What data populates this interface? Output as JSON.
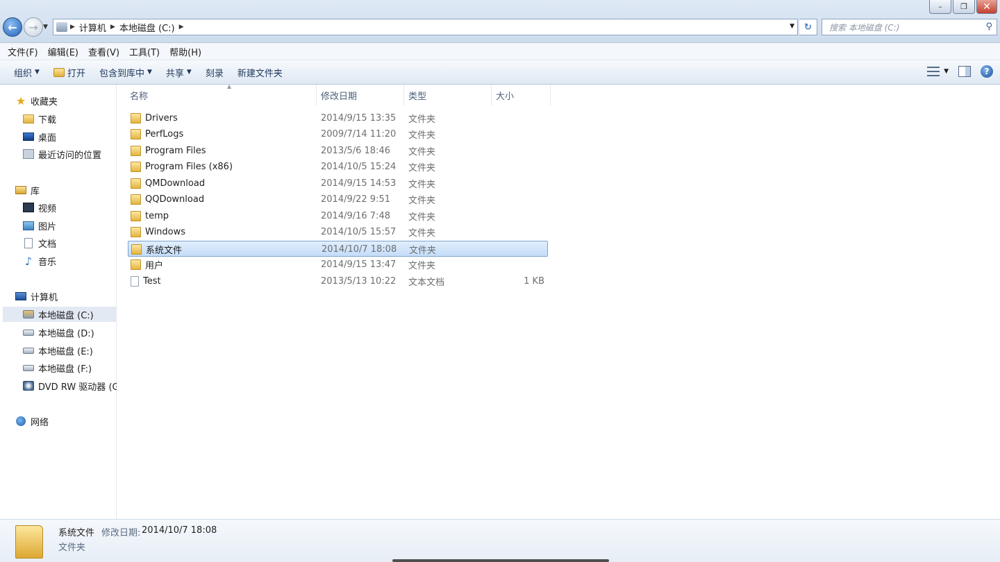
{
  "window": {
    "minimize_label": "–",
    "restore_label": "❐",
    "close_label": "✕"
  },
  "address": {
    "crumbs": [
      "计算机",
      "本地磁盘 (C:)"
    ]
  },
  "search": {
    "placeholder": "搜索 本地磁盘 (C:)"
  },
  "menu": [
    "文件(F)",
    "编辑(E)",
    "查看(V)",
    "工具(T)",
    "帮助(H)"
  ],
  "toolbar": {
    "organize": "组织",
    "open": "打开",
    "include_library": "包含到库中",
    "share": "共享",
    "burn": "刻录",
    "new_folder": "新建文件夹",
    "help": "?"
  },
  "nav": {
    "favorites": "收藏夹",
    "downloads": "下载",
    "desktop": "桌面",
    "recent": "最近访问的位置",
    "libraries": "库",
    "videos": "视频",
    "pictures": "图片",
    "documents": "文档",
    "music": "音乐",
    "computer": "计算机",
    "drive_c": "本地磁盘 (C:)",
    "drive_d": "本地磁盘 (D:)",
    "drive_e": "本地磁盘 (E:)",
    "drive_f": "本地磁盘 (F:)",
    "dvd": "DVD RW 驱动器 (G",
    "network": "网络"
  },
  "columns": {
    "name": "名称",
    "modified": "修改日期",
    "type": "类型",
    "size": "大小"
  },
  "files": [
    {
      "name": "Drivers",
      "date": "2014/9/15 13:35",
      "type": "文件夹",
      "size": ""
    },
    {
      "name": "PerfLogs",
      "date": "2009/7/14 11:20",
      "type": "文件夹",
      "size": ""
    },
    {
      "name": "Program Files",
      "date": "2013/5/6 18:46",
      "type": "文件夹",
      "size": ""
    },
    {
      "name": "Program Files (x86)",
      "date": "2014/10/5 15:24",
      "type": "文件夹",
      "size": ""
    },
    {
      "name": "QMDownload",
      "date": "2014/9/15 14:53",
      "type": "文件夹",
      "size": ""
    },
    {
      "name": "QQDownload",
      "date": "2014/9/22 9:51",
      "type": "文件夹",
      "size": ""
    },
    {
      "name": "temp",
      "date": "2014/9/16 7:48",
      "type": "文件夹",
      "size": ""
    },
    {
      "name": "Windows",
      "date": "2014/10/5 15:57",
      "type": "文件夹",
      "size": ""
    },
    {
      "name": "系统文件",
      "date": "2014/10/7 18:08",
      "type": "文件夹",
      "size": ""
    },
    {
      "name": "用户",
      "date": "2014/9/15 13:47",
      "type": "文件夹",
      "size": ""
    },
    {
      "name": "Test",
      "date": "2013/5/13 10:22",
      "type": "文本文档",
      "size": "1 KB"
    }
  ],
  "details": {
    "name": "系统文件",
    "modified_label": "修改日期:",
    "modified": "2014/10/7 18:08",
    "type": "文件夹"
  }
}
